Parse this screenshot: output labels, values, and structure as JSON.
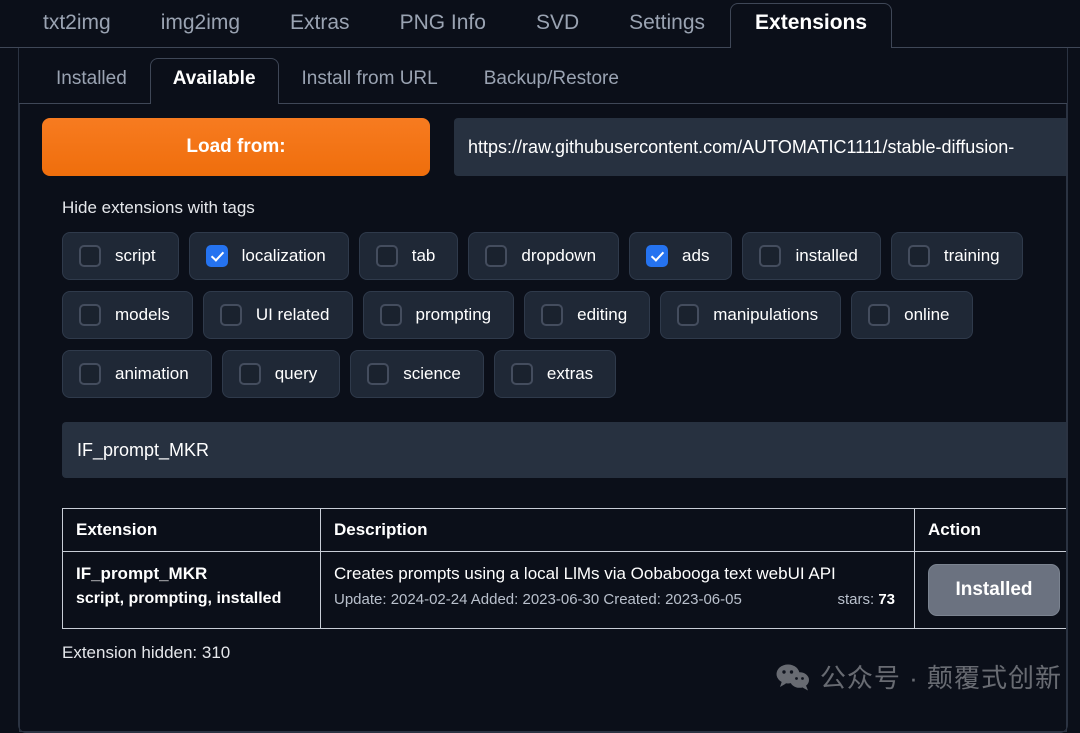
{
  "app": {
    "main_tabs": [
      {
        "label": "txt2img",
        "active": false
      },
      {
        "label": "img2img",
        "active": false
      },
      {
        "label": "Extras",
        "active": false
      },
      {
        "label": "PNG Info",
        "active": false
      },
      {
        "label": "SVD",
        "active": false
      },
      {
        "label": "Settings",
        "active": false
      },
      {
        "label": "Extensions",
        "active": true
      }
    ],
    "sub_tabs": [
      {
        "label": "Installed",
        "active": false
      },
      {
        "label": "Available",
        "active": true
      },
      {
        "label": "Install from URL",
        "active": false
      },
      {
        "label": "Backup/Restore",
        "active": false
      }
    ]
  },
  "load": {
    "button_label": "Load from:",
    "url_value": "https://raw.githubusercontent.com/AUTOMATIC1111/stable-diffusion-"
  },
  "filters": {
    "heading": "Hide extensions with tags",
    "rows": [
      [
        {
          "label": "script",
          "checked": false
        },
        {
          "label": "localization",
          "checked": true
        },
        {
          "label": "tab",
          "checked": false
        },
        {
          "label": "dropdown",
          "checked": false
        },
        {
          "label": "ads",
          "checked": true
        },
        {
          "label": "installed",
          "checked": false
        },
        {
          "label": "training",
          "checked": false
        }
      ],
      [
        {
          "label": "models",
          "checked": false
        },
        {
          "label": "UI related",
          "checked": false
        },
        {
          "label": "prompting",
          "checked": false
        },
        {
          "label": "editing",
          "checked": false
        },
        {
          "label": "manipulations",
          "checked": false
        },
        {
          "label": "online",
          "checked": false
        }
      ],
      [
        {
          "label": "animation",
          "checked": false
        },
        {
          "label": "query",
          "checked": false
        },
        {
          "label": "science",
          "checked": false
        },
        {
          "label": "extras",
          "checked": false
        }
      ]
    ]
  },
  "search": {
    "value": "IF_prompt_MKR",
    "placeholder": ""
  },
  "table": {
    "headers": {
      "extension": "Extension",
      "description": "Description",
      "action": "Action"
    },
    "rows": [
      {
        "name": "IF_prompt_MKR",
        "tags": "script, prompting, installed",
        "description": "Creates prompts using a local LlMs via Oobabooga text webUI API",
        "meta": "Update: 2024-02-24 Added: 2023-06-30 Created: 2023-06-05",
        "stars_label": "stars:",
        "stars_value": "73",
        "action_label": "Installed"
      }
    ]
  },
  "footer": {
    "status": "Extension hidden: 310"
  },
  "watermark": {
    "text": "公众号 · 颠覆式创新",
    "icon": "wechat-icon"
  },
  "colors": {
    "accent_orange": "#ef6e0c",
    "checkbox_blue": "#2573f0",
    "panel_bg": "#0b0f19",
    "field_bg": "#273140",
    "button_gray": "#6b7280"
  }
}
